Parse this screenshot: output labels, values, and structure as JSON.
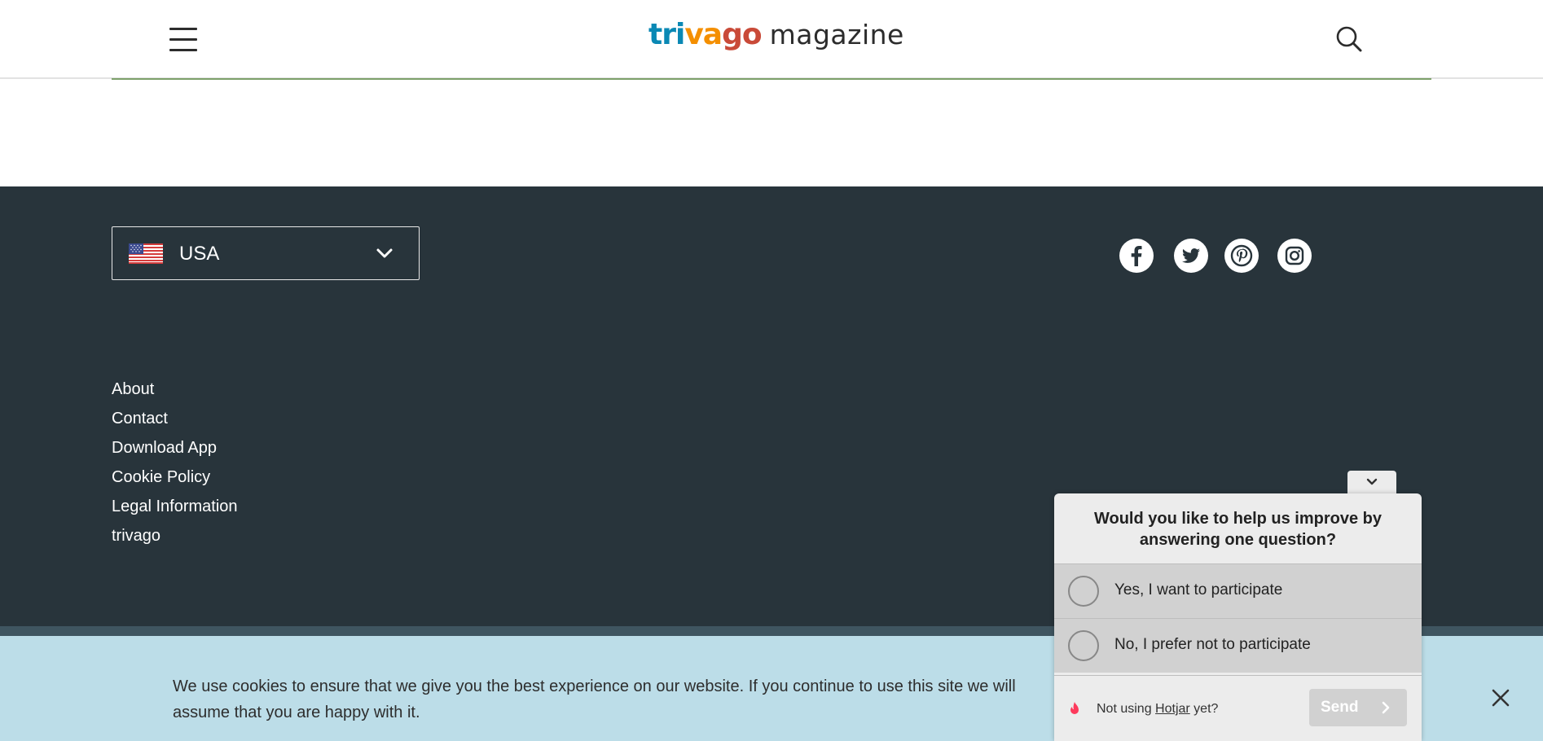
{
  "header": {
    "logo": {
      "part1": "tri",
      "part2": "va",
      "part3": "go",
      "suffix": "magazine"
    },
    "menu_icon": "hamburger-icon",
    "search_icon": "search-icon"
  },
  "footer": {
    "country_selector": {
      "label": "USA",
      "flag": "us-flag-icon",
      "chevron": "chevron-down-icon"
    },
    "social": [
      {
        "name": "facebook-icon"
      },
      {
        "name": "twitter-icon"
      },
      {
        "name": "pinterest-icon"
      },
      {
        "name": "instagram-icon"
      }
    ],
    "links": [
      "About",
      "Contact",
      "Download App",
      "Cookie Policy",
      "Legal Information",
      "trivago"
    ]
  },
  "cookie_bar": {
    "text": "We use cookies to ensure that we give you the best experience on our website. If you continue to use this site we will assume that you are happy with it.",
    "close_icon": "close-icon"
  },
  "survey": {
    "question": "Would you like to help us improve by answering one question?",
    "options": [
      "Yes, I want to participate",
      "No, I prefer not to participate"
    ],
    "footer_prefix": "Not using ",
    "footer_link": "Hotjar",
    "footer_suffix": " yet?",
    "send_label": "Send"
  },
  "colors": {
    "footer_bg": "#28343b",
    "cookie_bg": "#bcdde8",
    "accent_line": "#7da06b",
    "logo_blue": "#0a88b4",
    "logo_orange": "#f48f00",
    "logo_red": "#c94a38"
  }
}
